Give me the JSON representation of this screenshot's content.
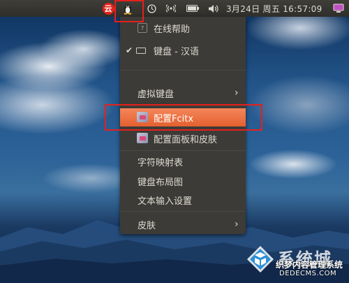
{
  "panel": {
    "netease_glyph": "云",
    "datetime": "3月24日 周五 16:57:09",
    "icons": [
      "netease-music-icon",
      "penguin-icon",
      "clock-icon",
      "wifi-icon",
      "battery-icon",
      "volume-icon",
      "session-icon"
    ]
  },
  "menu": {
    "items": [
      {
        "label": "在线帮助",
        "icon": "help-icon"
      },
      {
        "label": "键盘 - 汉语",
        "icon": "keyboard-icon",
        "checked": true
      },
      {
        "label": "虚拟键盘",
        "submenu": true
      },
      {
        "label": "配置Fcitx",
        "icon": "fcitx-config-icon",
        "highlighted": true
      },
      {
        "label": "配置面板和皮肤",
        "icon": "fcitx-skin-icon"
      },
      {
        "label": "字符映射表"
      },
      {
        "label": "键盘布局图"
      },
      {
        "label": "文本输入设置"
      },
      {
        "label": "皮肤",
        "submenu": true
      }
    ],
    "check_mark": "✔",
    "arrow": "›"
  },
  "watermark": {
    "title": "系统城",
    "subtitle": "织梦内容管理系统",
    "url": "DEDECMS.COM"
  },
  "colors": {
    "panel": "#3c3b37",
    "highlight": "#e9642f",
    "annotation": "#e5201c"
  }
}
